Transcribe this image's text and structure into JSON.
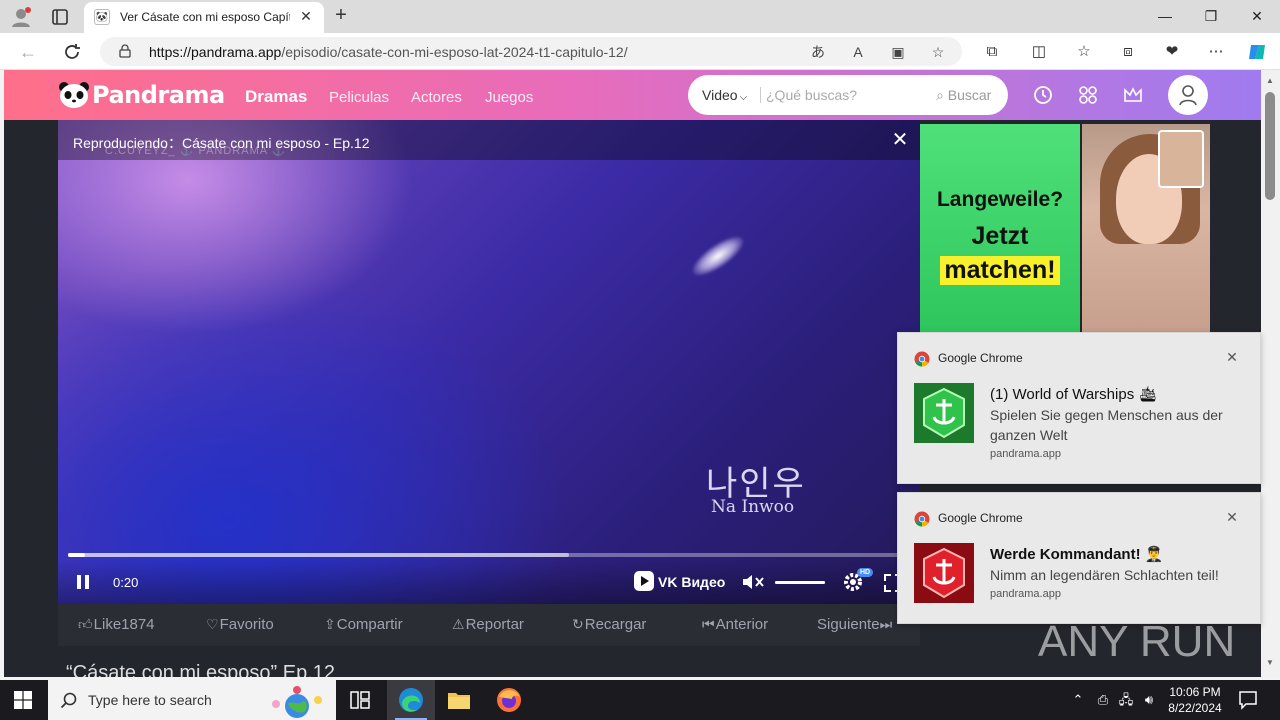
{
  "browser": {
    "tab_title": "Ver Cásate con mi esposo Capítul",
    "url_host": "https://pandrama.app",
    "url_path": "/episodio/casate-con-mi-esposo-lat-2024-t1-capitulo-12/"
  },
  "site": {
    "brand": "Pandrama",
    "nav": [
      "Dramas",
      "Peliculas",
      "Actores",
      "Juegos"
    ],
    "search": {
      "type_selected": "Video",
      "placeholder": "¿Qué buscas?",
      "button": "Buscar"
    }
  },
  "player": {
    "now_playing": "Reproduciendo：Cásate con mi esposo - Ep.12",
    "watermark": "C.CUYEYZ_ ⚓ PANDRAMA ⚓",
    "subtitle_korean": "나인우",
    "subtitle_latin": "Na Inwoo",
    "time": "0:20",
    "progress": 0.02,
    "buffered": 0.595,
    "volume": 1.0,
    "vk_label": "VK Видео",
    "hd_badge": "HD"
  },
  "actions": {
    "like": "Like1874",
    "favorite": "Favorito",
    "share": "Compartir",
    "report": "Reportar",
    "reload": "Recargar",
    "previous": "Anterior",
    "next": "Siguiente"
  },
  "below_title": "“Cásate con mi esposo” Ep.12",
  "ad": {
    "line1": "Langeweile?",
    "line2": "Jetzt",
    "line3": "matchen!",
    "accent_color": "#2ec65c"
  },
  "notifications": [
    {
      "app": "Google Chrome",
      "title": "(1) World of Warships 🛳",
      "body": "Spielen Sie gegen Menschen aus der ganzen Welt",
      "source": "pandrama.app",
      "thumb_color": "#27a83a"
    },
    {
      "app": "Google Chrome",
      "title": "Werde Kommandant! 👨‍✈️",
      "body": "Nimm an legendären Schlachten teil!",
      "source": "pandrama.app",
      "thumb_color": "#c8121b"
    }
  ],
  "watermark_brand": "ANY RUN",
  "taskbar": {
    "search_text": "Type here to search",
    "time": "10:06 PM",
    "date": "8/22/2024"
  }
}
